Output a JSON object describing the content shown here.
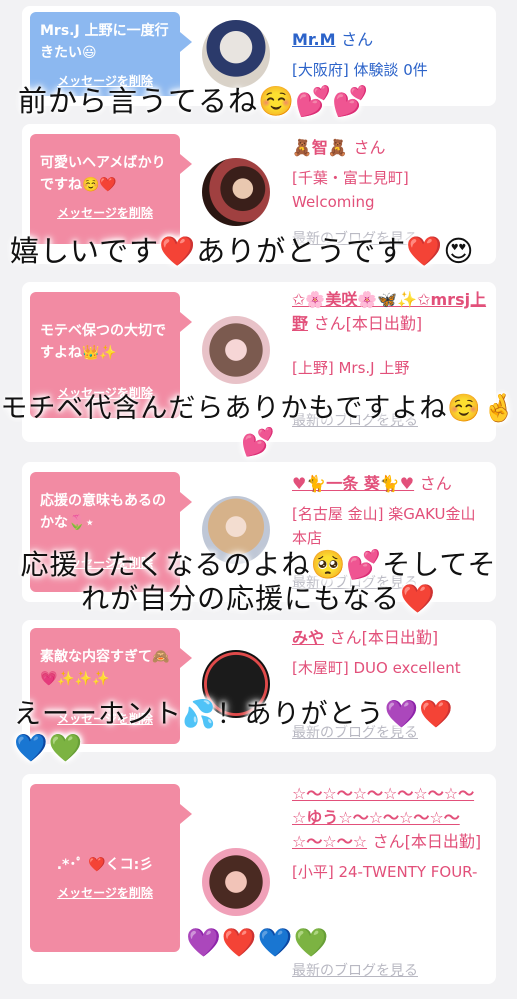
{
  "cards": [
    {
      "bubble_text": "Mrs.J 上野に一度行きたい😃",
      "delete": "メッセージを削除",
      "name": "Mr.M",
      "san": "さん",
      "meta": "[大阪府] 体験談 0件",
      "blog": ""
    },
    {
      "bubble_text": "可愛いヘアメばかりですね☺️❤️",
      "delete": "メッセージを削除",
      "name": "🧸智🧸",
      "san": "さん",
      "meta": "[千葉・富士見町] Welcoming",
      "blog": "最新のブログを見る"
    },
    {
      "bubble_text": "モテベ保つの大切ですよね👑✨",
      "delete": "メッセージを削除",
      "name": "✩🌸美咲🌸🦋✨✩mrsj上野",
      "san": "さん[本日出勤]",
      "meta": "[上野] Mrs.J 上野",
      "blog": "最新のブログを見る"
    },
    {
      "bubble_text": "応援の意味もあるのかな🌷⋆",
      "delete": "メッセージを削除",
      "name": "♥🐈一条 葵🐈♥",
      "san": "さん",
      "meta": "[名古屋 金山] 楽GAKU金山本店",
      "blog": "最新のブログを見る"
    },
    {
      "bubble_text": "素敵な内容すぎて🙈💗✨✨✨",
      "delete": "メッセージを削除",
      "name": "みや",
      "san": "さん[本日出勤]",
      "meta": "[木屋町] DUO excellent",
      "blog": "最新のブログを見る"
    },
    {
      "bubble_text": ".*･ﾟ ❤️くコ:彡",
      "delete": "メッセージを削除",
      "name": "☆〜☆〜☆〜☆〜☆〜☆〜☆ゆう☆〜☆〜☆〜☆〜☆〜☆〜☆",
      "san": "さん[本日出勤]",
      "meta": "[小平] 24-TWENTY FOUR-",
      "blog": "最新のブログを見る"
    }
  ],
  "overlays": [
    "前から言うてるね☺️💕💕",
    "嬉しいです❤️ありがとうです❤️😍",
    "モチベ代含んだらありかもですよね☺️🤞💕",
    "応援したくなるのよね🥺💕そしてそれが自分の応援にもなる❤️",
    "えーーホント💦！ありがとう💜❤️💙💚",
    "💜❤️💙💚"
  ],
  "colors": {
    "pink_bubble": "#f28ba3",
    "blue_bubble": "#8cb8f0",
    "name_pink": "#e2507a",
    "link_grey": "#b8b8c2"
  }
}
